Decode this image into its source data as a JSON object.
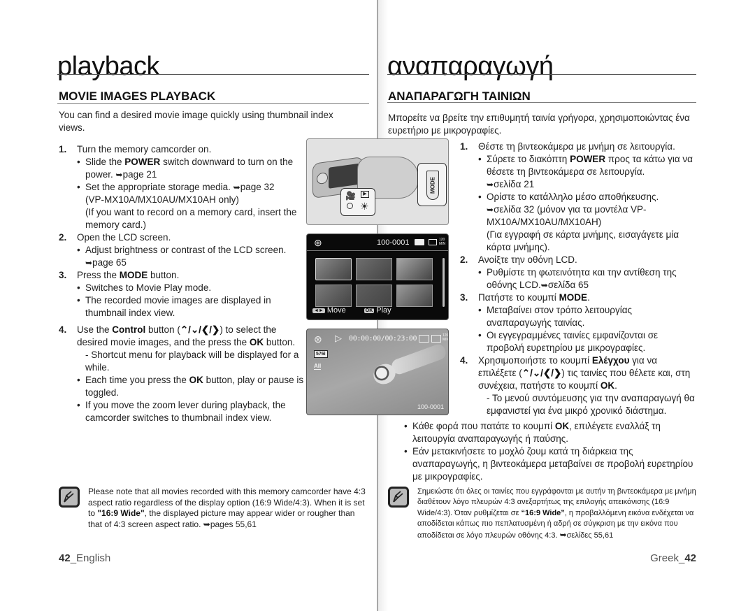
{
  "left": {
    "page_title": "playback",
    "section_title": "MOVIE IMAGES PLAYBACK",
    "intro": "You can find a desired movie image quickly using thumbnail index views.",
    "steps": [
      {
        "num": "1.",
        "text": "Turn the memory camcorder on.",
        "items": [
          {
            "type": "bullet",
            "pre": "Slide the ",
            "bold": "POWER",
            "post": " switch downward to turn on the power. ",
            "ref": "page 21"
          },
          {
            "type": "bullet",
            "pre": "Set the appropriate storage media. ",
            "bold": "",
            "post": "",
            "ref": "page 32"
          },
          {
            "type": "sub",
            "text": "(VP-MX10A/MX10AU/MX10AH only)"
          },
          {
            "type": "sub",
            "text": "(If you want to record on a memory card, insert the memory card.)"
          }
        ]
      },
      {
        "num": "2.",
        "text": "Open the LCD screen.",
        "items": [
          {
            "type": "bullet",
            "pre": "Adjust brightness or contrast of the LCD screen. ",
            "bold": "",
            "post": "",
            "ref": "page 65"
          }
        ]
      },
      {
        "num": "3.",
        "text_pre": "Press the ",
        "text_bold": "MODE",
        "text_post": " button.",
        "items": [
          {
            "type": "bullet",
            "text": "Switches to Movie Play mode."
          },
          {
            "type": "bullet",
            "text": "The recorded movie images are displayed in thumbnail index view."
          }
        ]
      },
      {
        "num": "4.",
        "text_pre": "Use the ",
        "text_bold": "Control",
        "text_mid": " button (",
        "arrows": "⌃/⌄/❮/❯",
        "text_mid2": ") to select the desired movie images, and the press the ",
        "text_bold2": "OK",
        "text_post": " button.",
        "items": [
          {
            "type": "dash",
            "text": "- Shortcut menu for playback will be displayed for a while."
          },
          {
            "type": "bullet",
            "pre": "Each time you press the ",
            "bold": "OK",
            "post": " button, play or pause is toggled."
          },
          {
            "type": "bullet",
            "text": "If you move the zoom lever during playback, the camcorder switches to thumbnail index view."
          }
        ]
      }
    ],
    "note": {
      "icon": "note-pencil-icon",
      "line1": "Please note that all movies recorded with this memory camcorder have 4:3 aspect ratio regardless of the display option (16:9 Wide/4:3). When it is set to ",
      "bold": "\"16:9 Wide\"",
      "line2": ", the displayed picture may appear wider or rougher than that of 4:3 screen aspect ratio. ",
      "ref": "pages 55,61"
    },
    "footer": {
      "page_num": "42",
      "label": "_English"
    }
  },
  "right": {
    "page_title": "αναπαραγωγή",
    "section_title": "ΑΝΑΠΑΡΑΓΩΓΗ ΤΑΙΝΙΩΝ",
    "intro": "Μπορείτε να βρείτε την επιθυμητή ταινία γρήγορα, χρησιμοποιώντας ένα ευρετήριο με μικρογραφίες.",
    "steps": [
      {
        "num": "1.",
        "text": "Θέστε τη βιντεοκάμερα με μνήμη σε λειτουργία.",
        "b1_pre": "Σύρετε το διακόπτη ",
        "b1_bold": "POWER",
        "b1_post": " προς τα κάτω για να θέσετε τη βιντεοκάμερα σε λειτουργία.",
        "b1_ref": "σελίδα 21",
        "b2_text": "Ορίστε το κατάλληλο μέσο αποθήκευσης.",
        "b2_ref": "σελίδα 32 (μόνον για τα μοντέλα VP-MX10A/MX10AU/MX10AH)",
        "b2_sub": "(Για εγγραφή σε κάρτα μνήμης, εισαγάγετε μία κάρτα μνήμης)."
      },
      {
        "num": "2.",
        "text": "Ανοίξτε την οθόνη LCD.",
        "b1_text": "Ρυθμίστε τη φωτεινότητα και την αντίθεση της οθόνης LCD.",
        "b1_ref": "σελίδα 65"
      },
      {
        "num": "3.",
        "text_pre": "Πατήστε το κουμπί ",
        "text_bold": "MODE",
        "text_post": ".",
        "b1_text": "Μεταβαίνει στον τρόπο λειτουργίας αναπαραγωγής ταινίας.",
        "b2_text": "Οι εγγεγραμμένες ταινίες εμφανίζονται σε προβολή ευρετηρίου με μικρογραφίες."
      },
      {
        "num": "4.",
        "text_pre": "Χρησιμοποιήστε το κουμπί ",
        "text_bold": "Ελέγχου",
        "text_mid": " για να επιλέξετε (",
        "arrows": "⌃/⌄/❮/❯",
        "text_mid2": ") τις ταινίες που θέλετε και, στη συνέχεια, πατήστε το κουμπί ",
        "text_bold2": "OK",
        "text_post": ".",
        "dash": "- Το μενού συντόμευσης για την αναπαραγωγή θα εμφανιστεί για ένα μικρό χρονικό διάστημα.",
        "b1_pre": "Κάθε φορά που πατάτε το κουμπί ",
        "b1_bold": "OK",
        "b1_post": ", επιλέγετε εναλλάξ τη λειτουργία αναπαραγωγής ή παύσης.",
        "b2_text": "Εάν μετακινήσετε το μοχλό ζουμ κατά τη διάρκεια της αναπαραγωγής, η βιντεοκάμερα μεταβαίνει σε προβολή ευρετηρίου με μικρογραφίες."
      }
    ],
    "note": {
      "icon": "note-pencil-icon",
      "line1": "Σημειώστε ότι όλες οι ταινίες που εγγράφονται με αυτήν τη βιντεοκάμερα με μνήμη διαθέτουν λόγο πλευρών 4:3 ανεξαρτήτως της επιλογής απεικόνισης (16:9 Wide/4:3). Όταν ρυθμίζεται σε ",
      "bold": "“16:9 Wide”",
      "line2": ", η προβαλλόμενη εικόνα ενδέχεται να αποδίδεται κάπως πιο πεπλατυσμένη ή αδρή σε σύγκριση με την εικόνα που αποδίδεται σε λόγο πλευρών οθόνης 4:3. ",
      "ref": "σελίδες 55,61"
    },
    "footer": {
      "label": "Greek_",
      "page_num": "42"
    }
  },
  "illustrations": {
    "camcorder": {
      "mode_label": "MODE",
      "cam_icon": "🎥",
      "play_icon": "▶",
      "led_on": "☀"
    },
    "thumbnail_screen": {
      "file_number": "100-0001",
      "remaining": "120 MIN",
      "move_key": "◄►",
      "move_label": "Move",
      "ok_key": "OK",
      "play_label": "Play",
      "thumb_colors": [
        "#8a8a8a",
        "#6e6e6e",
        "#a5a5a5",
        "#7a7a7a",
        "#5e5e5e",
        "#9a9a9a"
      ]
    },
    "playback_screen": {
      "time": "00:00:00/00:23:00",
      "quality": "576i",
      "all_label": "All",
      "remaining": "120 MIN",
      "file_number": "100-0001"
    }
  },
  "arrow_glyph": "➥"
}
